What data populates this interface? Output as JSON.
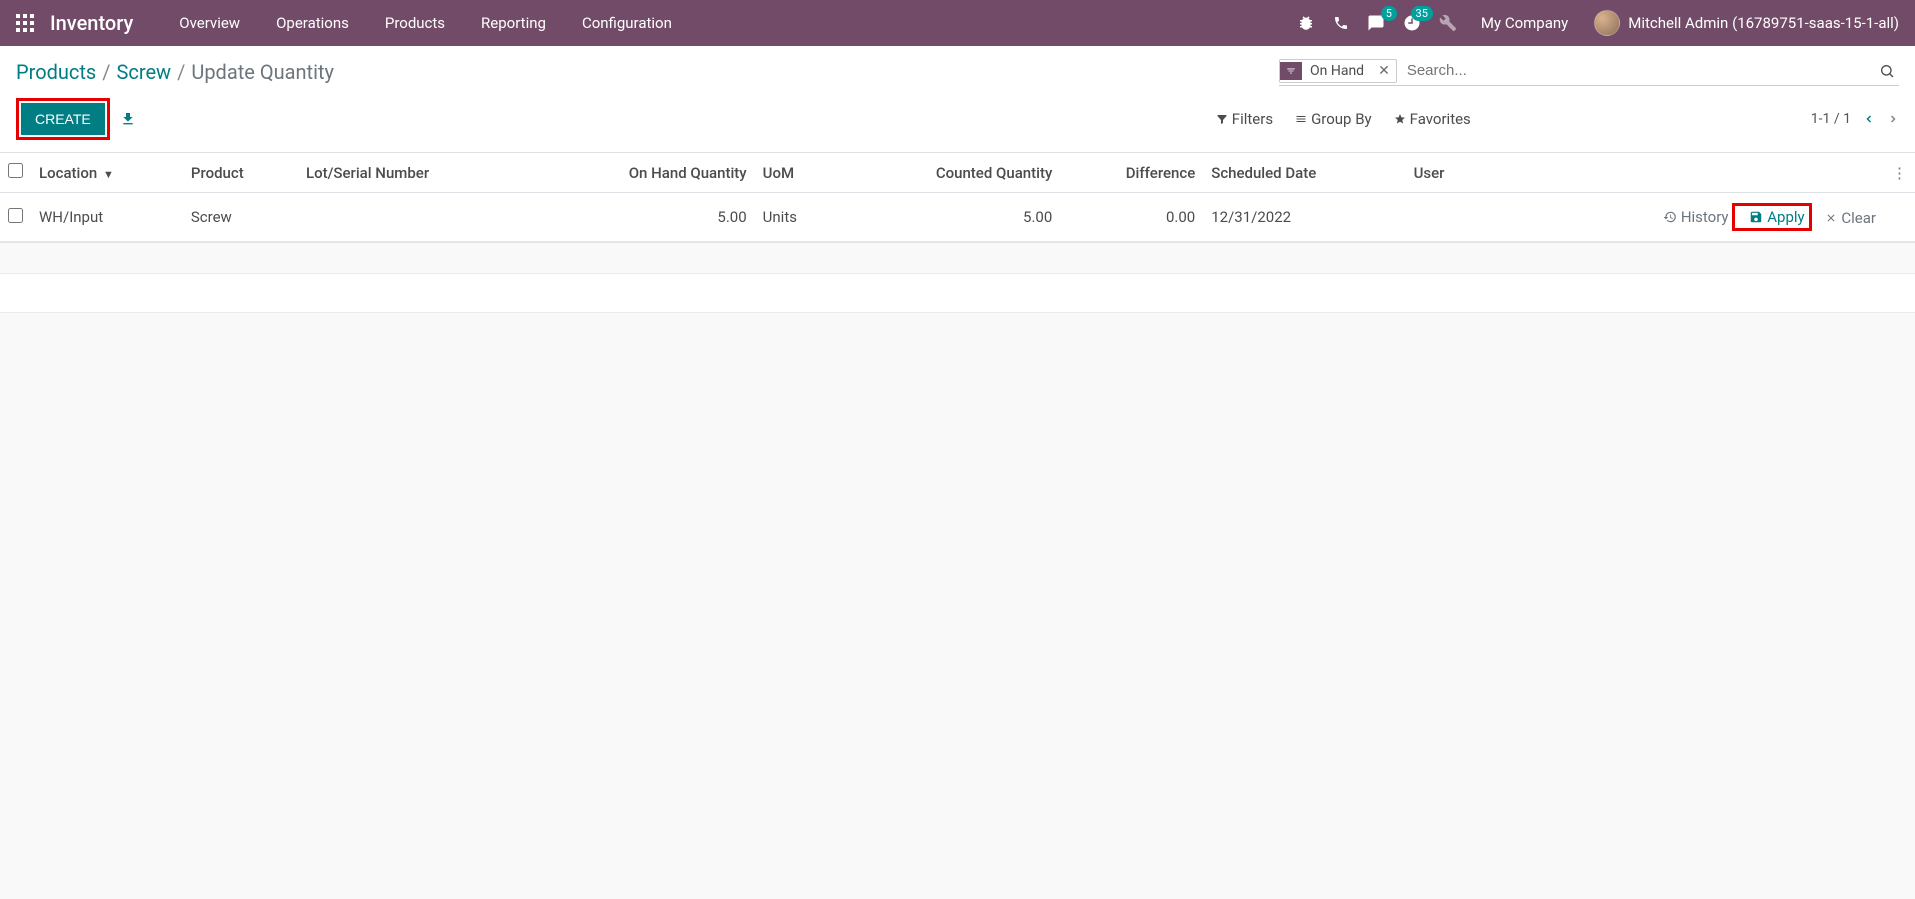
{
  "topnav": {
    "brand": "Inventory",
    "menu": [
      "Overview",
      "Operations",
      "Products",
      "Reporting",
      "Configuration"
    ],
    "messages_badge": "5",
    "activities_badge": "35",
    "company": "My Company",
    "user": "Mitchell Admin (16789751-saas-15-1-all)"
  },
  "breadcrumb": {
    "items": [
      "Products",
      "Screw"
    ],
    "current": "Update Quantity"
  },
  "search": {
    "facet_label": "On Hand",
    "placeholder": "Search..."
  },
  "buttons": {
    "create": "CREATE"
  },
  "search_options": {
    "filters": "Filters",
    "group_by": "Group By",
    "favorites": "Favorites"
  },
  "pager": {
    "range": "1-1 / 1"
  },
  "table": {
    "headers": {
      "location": "Location",
      "product": "Product",
      "lot": "Lot/Serial Number",
      "on_hand": "On Hand Quantity",
      "uom": "UoM",
      "counted": "Counted Quantity",
      "difference": "Difference",
      "scheduled": "Scheduled Date",
      "user": "User"
    },
    "rows": [
      {
        "location": "WH/Input",
        "product": "Screw",
        "lot": "",
        "on_hand": "5.00",
        "uom": "Units",
        "counted": "5.00",
        "difference": "0.00",
        "scheduled": "12/31/2022",
        "user": ""
      }
    ],
    "actions": {
      "history": "History",
      "apply": "Apply",
      "clear": "Clear"
    }
  }
}
